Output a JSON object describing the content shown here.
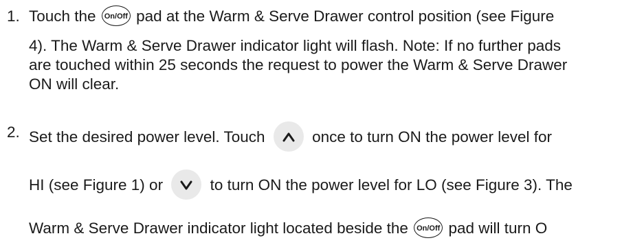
{
  "step1": {
    "number": "1.",
    "l1_a": "Touch the",
    "l1_b": "pad at the Warm & Serve Drawer control position (see Figure",
    "l2": "4). The Warm & Serve Drawer indicator light will flash. Note: If no further pads",
    "l3": "are touched within 25 seconds the request to power the Warm & Serve Drawer",
    "l4": "ON will clear."
  },
  "step2": {
    "number": "2.",
    "l1_a": "Set the desired power level. Touch",
    "l1_b": "once to turn ON the power level for",
    "l2_a": "HI (see Figure 1) or",
    "l2_b": "to turn ON the power level for LO (see Figure 3). The",
    "l3_a": "Warm & Serve Drawer indicator light located beside the",
    "l3_b": "pad will turn O"
  },
  "onoff_label": "On/Off",
  "icons": {
    "onoff": "on-off-pad-icon",
    "up": "chevron-up-icon",
    "down": "chevron-down-icon"
  }
}
